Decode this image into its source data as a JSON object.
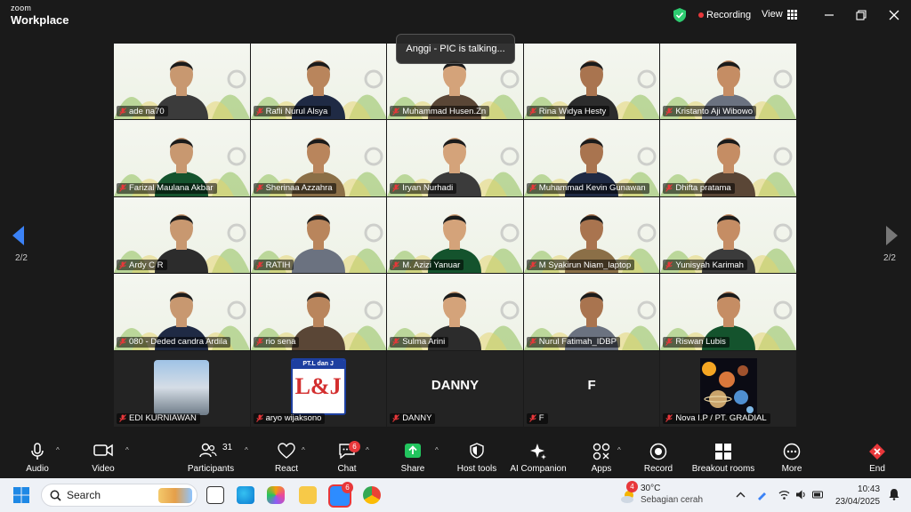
{
  "titlebar": {
    "brand_line1": "zoom",
    "brand_line2": "Workplace",
    "recording_label": "Recording",
    "view_label": "View"
  },
  "toast": "Anggi - PIC is talking...",
  "pager": {
    "left": "2/2",
    "right": "2/2"
  },
  "participants": [
    {
      "name": "ade na70",
      "kind": "video"
    },
    {
      "name": "Rafli Nurul Alsya",
      "kind": "video"
    },
    {
      "name": "Muhammad Husen.Zn",
      "kind": "video"
    },
    {
      "name": "Rina Widya Hesty",
      "kind": "video"
    },
    {
      "name": "Kristanto Aji Wibowo",
      "kind": "video"
    },
    {
      "name": "Farizal Maulana Akbar",
      "kind": "video"
    },
    {
      "name": "Sherinaa Azzahra",
      "kind": "video"
    },
    {
      "name": "Iryan Nurhadi",
      "kind": "video"
    },
    {
      "name": "Muhammad Kevin Gunawan",
      "kind": "video"
    },
    {
      "name": "Dhifta pratama",
      "kind": "video"
    },
    {
      "name": "Ardy C R",
      "kind": "video"
    },
    {
      "name": "RATIH",
      "kind": "video"
    },
    {
      "name": "M. Azizi Yanuar",
      "kind": "video"
    },
    {
      "name": "M Syakirun Niam_laptop",
      "kind": "video"
    },
    {
      "name": "Yunisyah Karimah",
      "kind": "video"
    },
    {
      "name": "080 - Deded candra Ardila",
      "kind": "video"
    },
    {
      "name": "rio sena",
      "kind": "video"
    },
    {
      "name": "Sulma Arini",
      "kind": "video"
    },
    {
      "name": "Nurul Fatimah_IDBP",
      "kind": "video"
    },
    {
      "name": "Riswan Lubis",
      "kind": "video"
    },
    {
      "name": "EDI KURNIAWAN",
      "kind": "photo"
    },
    {
      "name": "aryo wijaksono",
      "kind": "logo",
      "logo_text": "L&J",
      "logo_top": "PT.L dan J"
    },
    {
      "name": "DANNY",
      "kind": "text",
      "display": "DANNY"
    },
    {
      "name": "F",
      "kind": "text",
      "display": "F"
    },
    {
      "name": "Nova I.P / PT. GRADIAL",
      "kind": "planets"
    }
  ],
  "toolbar": {
    "audio": "Audio",
    "video": "Video",
    "participants": "Participants",
    "participants_count": "31",
    "react": "React",
    "chat": "Chat",
    "chat_badge": "6",
    "share": "Share",
    "host_tools": "Host tools",
    "ai_companion": "AI Companion",
    "apps": "Apps",
    "record": "Record",
    "breakout_rooms": "Breakout rooms",
    "more": "More",
    "end": "End"
  },
  "taskbar": {
    "search_placeholder": "Search",
    "zoom_badge": "6",
    "weather_badge": "4",
    "temperature": "30°C",
    "weather_desc": "Sebagian cerah",
    "time": "10:43",
    "date": "23/04/2025"
  },
  "colors": {
    "accent_green": "#2ecc71",
    "recording_red": "#e8373a",
    "share_green": "#22c55e",
    "toolbar_bg": "#1a1a1a"
  }
}
